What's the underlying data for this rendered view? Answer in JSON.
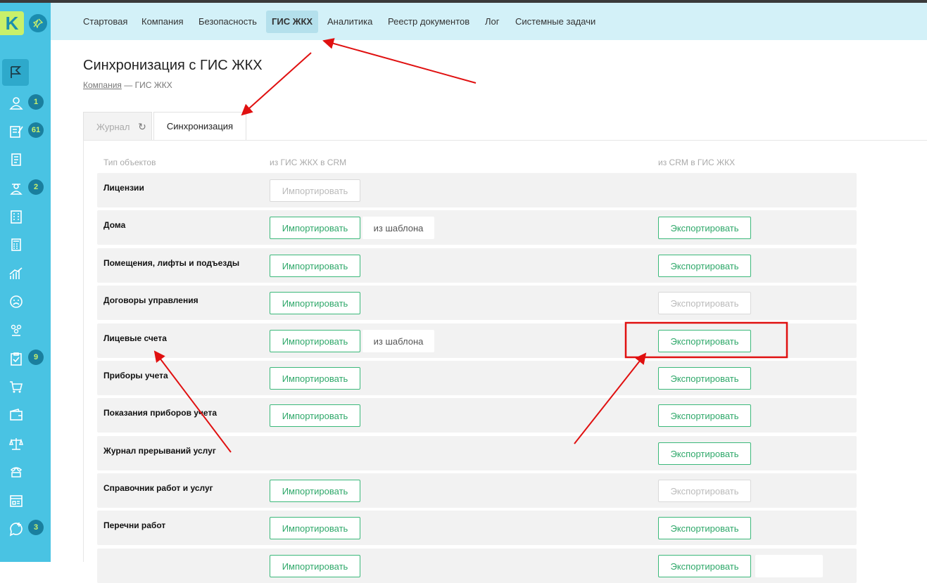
{
  "sidebar": {
    "logo_text": "K",
    "items": [
      {
        "icon": "flag-icon",
        "badge": ""
      },
      {
        "icon": "users-icon",
        "badge": "1"
      },
      {
        "icon": "edit-list-icon",
        "badge": "61"
      },
      {
        "icon": "documents-icon",
        "badge": ""
      },
      {
        "icon": "worker-icon",
        "badge": "2"
      },
      {
        "icon": "building-icon",
        "badge": ""
      },
      {
        "icon": "calculator-icon",
        "badge": ""
      },
      {
        "icon": "chart-icon",
        "badge": ""
      },
      {
        "icon": "sad-face-icon",
        "badge": ""
      },
      {
        "icon": "group-icon",
        "badge": ""
      },
      {
        "icon": "clipboard-check-icon",
        "badge": "9"
      },
      {
        "icon": "cart-icon",
        "badge": ""
      },
      {
        "icon": "wallet-icon",
        "badge": ""
      },
      {
        "icon": "scales-icon",
        "badge": ""
      },
      {
        "icon": "phone-icon",
        "badge": ""
      },
      {
        "icon": "card-icon",
        "badge": ""
      },
      {
        "icon": "chat-add-icon",
        "badge": "3"
      }
    ]
  },
  "topnav": {
    "items": [
      "Стартовая",
      "Компания",
      "Безопасность",
      "ГИС ЖКХ",
      "Аналитика",
      "Реестр документов",
      "Лог",
      "Системные задачи"
    ],
    "active": "ГИС ЖКХ"
  },
  "page": {
    "title": "Синхронизация с ГИС ЖКХ",
    "breadcrumb_link": "Компания",
    "breadcrumb_sep": " — ",
    "breadcrumb_current": "ГИС ЖКХ"
  },
  "tabs": {
    "journal": "Журнал",
    "sync": "Синхронизация"
  },
  "table": {
    "headers": [
      "Тип объектов",
      "из ГИС ЖКХ в CRM",
      "из CRM в ГИС ЖКХ"
    ],
    "import_label": "Импортировать",
    "template_label": "из шаблона",
    "export_label": "Экспортировать",
    "rows": [
      {
        "label": "Лицензии",
        "import": "disabled",
        "template": false,
        "export": "none"
      },
      {
        "label": "Дома",
        "import": "enabled",
        "template": true,
        "export": "enabled"
      },
      {
        "label": "Помещения, лифты и подъезды",
        "import": "enabled",
        "template": false,
        "export": "enabled"
      },
      {
        "label": "Договоры управления",
        "import": "enabled",
        "template": false,
        "export": "disabled"
      },
      {
        "label": "Лицевые счета",
        "import": "enabled",
        "template": true,
        "export": "enabled"
      },
      {
        "label": "Приборы учета",
        "import": "enabled",
        "template": false,
        "export": "enabled"
      },
      {
        "label": "Показания приборов учета",
        "import": "enabled",
        "template": false,
        "export": "enabled"
      },
      {
        "label": "Журнал прерываний услуг",
        "import": "none",
        "template": false,
        "export": "enabled"
      },
      {
        "label": "Справочник работ и услуг",
        "import": "enabled",
        "template": false,
        "export": "disabled"
      },
      {
        "label": "Перечни работ",
        "import": "enabled",
        "template": false,
        "export": "enabled"
      },
      {
        "label": "",
        "import": "enabled",
        "template": false,
        "export": "enabled"
      }
    ]
  },
  "colors": {
    "sidebar": "#49c3e3",
    "topnav": "#d3f1f8",
    "accent_green": "#2fa86a",
    "annotation_red": "#e01010"
  }
}
